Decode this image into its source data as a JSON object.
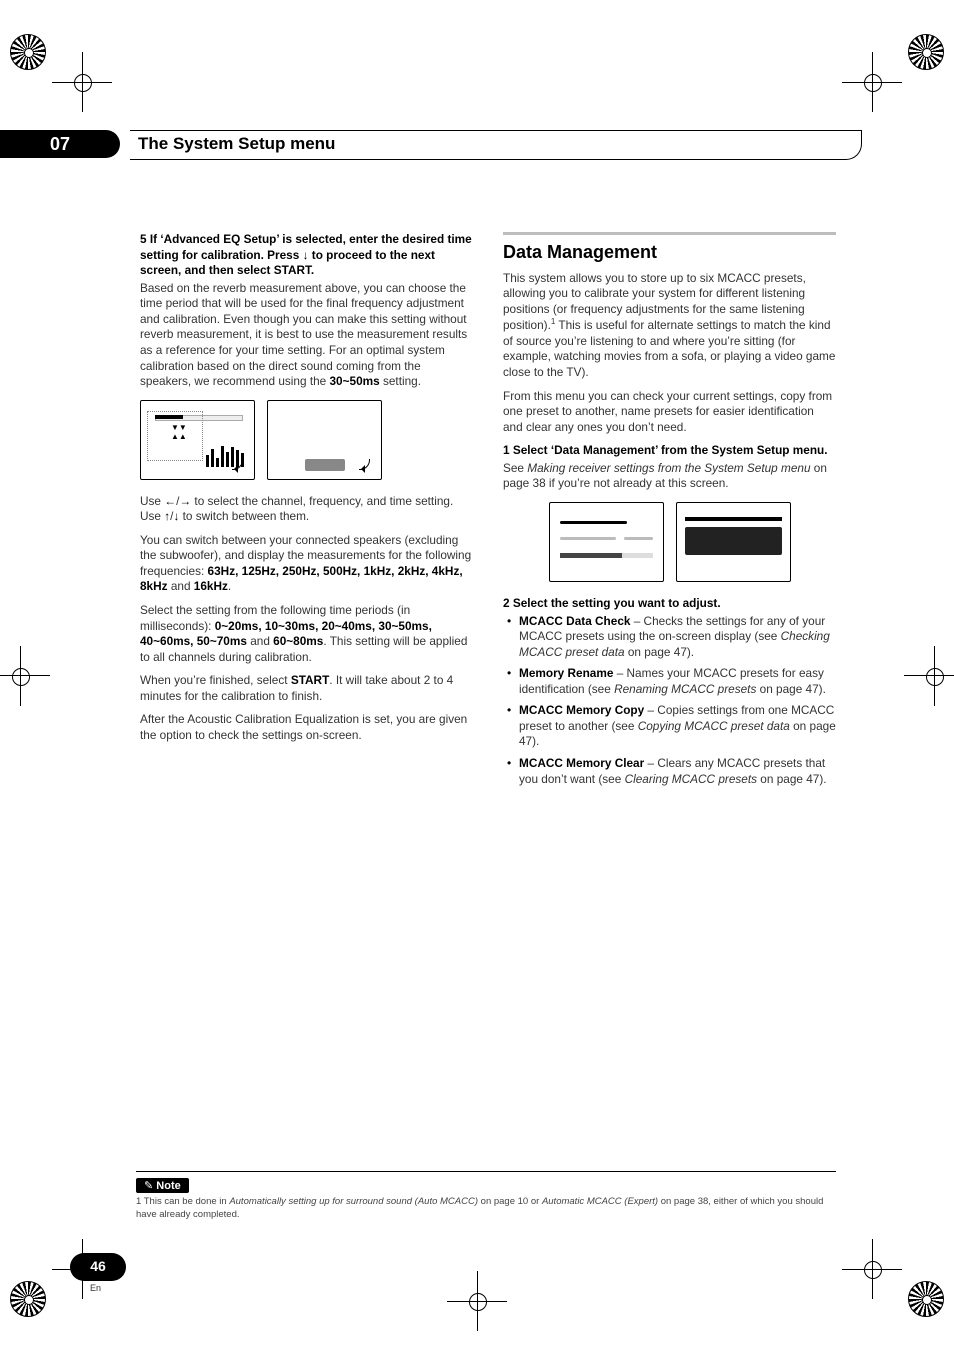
{
  "chapter": {
    "number": "07",
    "title": "The System Setup menu"
  },
  "leftCol": {
    "step5_head_a": "5    If ‘Advanced EQ Setup’ is selected, enter the desired time setting for calibration. Press ",
    "step5_head_arrow": "↓",
    "step5_head_b": " to proceed to the next screen, and then select START.",
    "p1": "Based on the reverb measurement above, you can choose the time period that will be used for the final frequency adjustment and calibration. Even though you can make this setting without reverb measurement, it is best to use the measurement results as a reference for your time setting. For an optimal system calibration based on the direct sound coming from the speakers, we recommend using the ",
    "p1_strong": "30~50ms",
    "p1_tail": " setting.",
    "p2a": "Use ",
    "p2_left": "←",
    "p2_slash": "/",
    "p2_right": "→",
    "p2b": " to select the channel, frequency, and time setting. Use ",
    "p2_up": "↑",
    "p2_down": "↓",
    "p2c": " to switch between them.",
    "p3a": "You can switch between your connected speakers (excluding the subwoofer), and display the measurements for the following frequencies: ",
    "p3_freqs": "63Hz, 125Hz, 250Hz, 500Hz, 1kHz, 2kHz, 4kHz, 8kHz",
    "p3_and": " and ",
    "p3_last": "16kHz",
    "p3_tail": ".",
    "p4a": "Select the setting from the following time periods (in milliseconds): ",
    "p4_opts": "0~20ms, 10~30ms, 20~40ms, 30~50ms, 40~60ms, 50~70ms",
    "p4_and": " and ",
    "p4_last": "60~80ms",
    "p4_tail": ". This setting will be applied to all channels during calibration.",
    "p5a": "When you’re finished, select ",
    "p5_start": "START",
    "p5b": ". It will take about 2 to 4 minutes for the calibration to finish.",
    "p6": "After the Acoustic Calibration Equalization is set, you are given the option to check the settings on-screen."
  },
  "rightCol": {
    "section_title": "Data Management",
    "intro1": "This system allows you to store up to six MCACC presets, allowing you to calibrate your system for different listening positions (or frequency adjustments for the same listening position).",
    "sup1": "1",
    "intro1b": " This is useful for alternate settings to match the kind of source you’re listening to and where you’re sitting (for example, watching movies from a sofa, or playing a video game close to the TV).",
    "intro2": "From this menu you can check your current settings, copy from one preset to another, name presets for easier identification and clear any ones you don’t need.",
    "step1_head": "1    Select ‘Data Management’ from the System Setup menu.",
    "step1_body_a": "See ",
    "step1_body_i": "Making receiver settings from the System Setup menu",
    "step1_body_b": " on page 38 if you’re not already at this screen.",
    "step2_head": "2    Select the setting you want to adjust.",
    "bullets": [
      {
        "head": "MCACC Data Check",
        "body_a": " – Checks the settings for any of your MCACC presets using the on-screen display (see ",
        "body_i": "Checking MCACC preset data",
        "body_b": " on page 47)."
      },
      {
        "head": "Memory Rename",
        "body_a": " – Names your MCACC presets for easy identification (see ",
        "body_i": "Renaming MCACC presets",
        "body_b": " on page 47)."
      },
      {
        "head": "MCACC Memory Copy",
        "body_a": " – Copies settings from one MCACC preset to another (see ",
        "body_i": "Copying MCACC preset data",
        "body_b": " on page 47)."
      },
      {
        "head": "MCACC Memory Clear",
        "body_a": " – Clears any MCACC presets that you don’t want (see ",
        "body_i": "Clearing MCACC presets",
        "body_b": " on page 47)."
      }
    ]
  },
  "note": {
    "label": "Note",
    "text_a": "1 This can be done in ",
    "text_i1": "Automatically setting up for surround sound (Auto MCACC)",
    "text_b": " on page 10 or ",
    "text_i2": "Automatic MCACC (Expert)",
    "text_c": " on page 38, either of which you should have already completed."
  },
  "pagenum": {
    "num": "46",
    "lang": "En"
  }
}
